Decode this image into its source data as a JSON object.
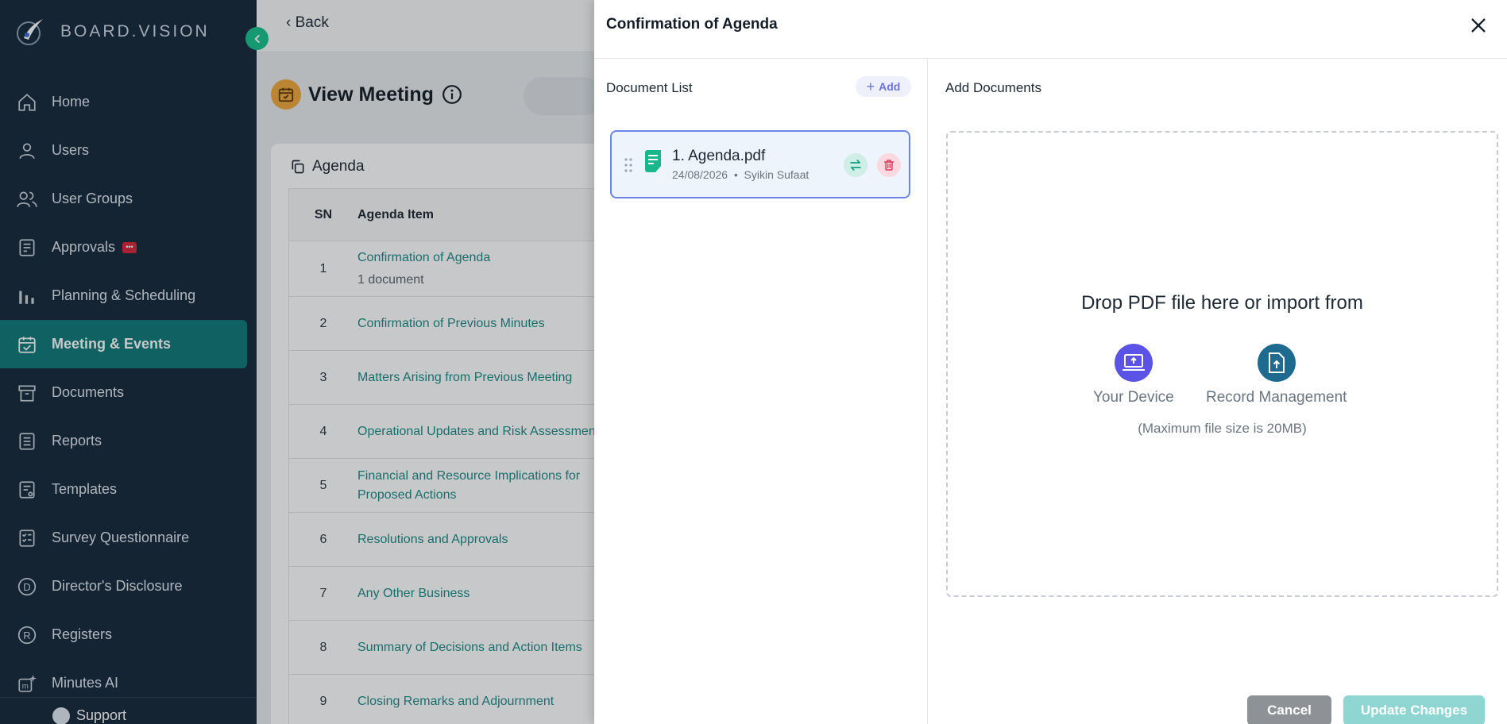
{
  "sidebar": {
    "brand": "BOARD.VISION",
    "items": [
      {
        "label": "Home",
        "icon": "home-icon"
      },
      {
        "label": "Users",
        "icon": "user-icon"
      },
      {
        "label": "User Groups",
        "icon": "users-icon"
      },
      {
        "label": "Approvals",
        "icon": "approval-icon",
        "badge": "chat-badge"
      },
      {
        "label": "Planning & Scheduling",
        "icon": "bar-chart-icon"
      },
      {
        "label": "Meeting & Events",
        "icon": "calendar-check-icon",
        "active": true
      },
      {
        "label": "Documents",
        "icon": "archive-icon"
      },
      {
        "label": "Reports",
        "icon": "list-icon"
      },
      {
        "label": "Templates",
        "icon": "template-icon"
      },
      {
        "label": "Survey Questionnaire",
        "icon": "survey-icon"
      },
      {
        "label": "Director's Disclosure",
        "icon": "d-circle-icon"
      },
      {
        "label": "Registers",
        "icon": "r-circle-icon"
      },
      {
        "label": "Minutes AI",
        "icon": "minutes-ai-icon"
      }
    ],
    "support": "Support",
    "active_color": "#0f7a78"
  },
  "main": {
    "back": "Back",
    "title": "View Meeting",
    "agenda": {
      "heading": "Agenda",
      "columns": [
        "SN",
        "Agenda Item"
      ],
      "rows": [
        {
          "sn": "1",
          "item": "Confirmation of Agenda",
          "sub": "1 document"
        },
        {
          "sn": "2",
          "item": "Confirmation of Previous Minutes",
          "sub": ""
        },
        {
          "sn": "3",
          "item": "Matters Arising from Previous Meeting",
          "sub": ""
        },
        {
          "sn": "4",
          "item": "Operational Updates and Risk Assessment",
          "sub": ""
        },
        {
          "sn": "5",
          "item": "Financial and Resource Implications for Proposed Actions",
          "sub": ""
        },
        {
          "sn": "6",
          "item": "Resolutions and Approvals",
          "sub": ""
        },
        {
          "sn": "7",
          "item": "Any Other Business",
          "sub": ""
        },
        {
          "sn": "8",
          "item": "Summary of Decisions and Action Items",
          "sub": ""
        },
        {
          "sn": "9",
          "item": "Closing Remarks and Adjournment",
          "sub": ""
        }
      ]
    }
  },
  "drawer": {
    "title": "Confirmation of Agenda",
    "document_list_label": "Document List",
    "add_label": "Add",
    "documents": [
      {
        "name": "1. Agenda.pdf",
        "date": "24/08/2026",
        "separator": "•",
        "author": "Syikin Sufaat"
      }
    ],
    "add_documents_label": "Add Documents",
    "drop_text": "Drop PDF file here or import from",
    "sources": [
      {
        "label": "Your Device",
        "color": "#5b52e6"
      },
      {
        "label": "Record Management",
        "color": "#1f6b8f"
      }
    ],
    "max_note": "(Maximum file size is 20MB)",
    "cancel": "Cancel",
    "update": "Update Changes"
  }
}
